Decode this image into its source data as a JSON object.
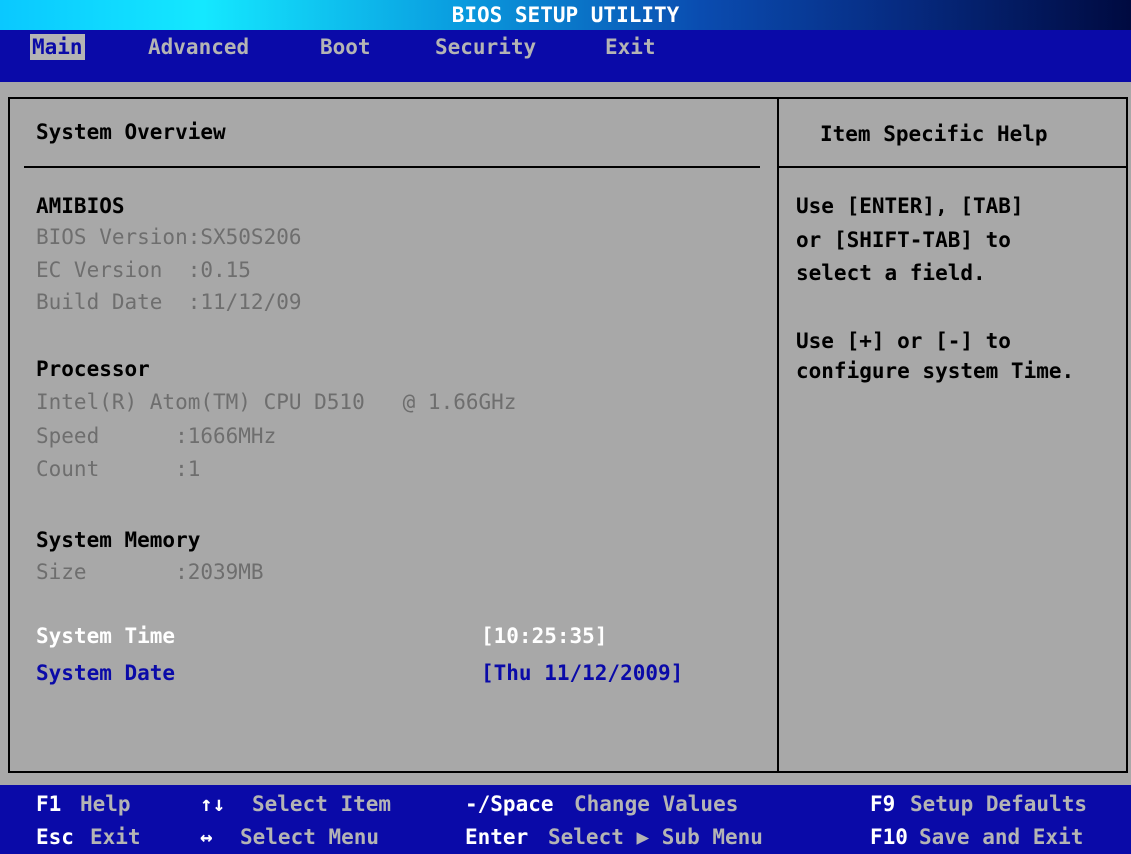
{
  "title": "BIOS SETUP UTILITY",
  "menu": [
    {
      "label": "Main",
      "active": true
    },
    {
      "label": "Advanced",
      "active": false
    },
    {
      "label": "Boot",
      "active": false
    },
    {
      "label": "Security",
      "active": false
    },
    {
      "label": "Exit",
      "active": false
    }
  ],
  "main": {
    "section_title": "System Overview",
    "amibios": {
      "heading": "AMIBIOS",
      "bios_version": "BIOS Version:SX50S206",
      "ec_version": "EC Version  :0.15",
      "build_date": "Build Date  :11/12/09"
    },
    "processor": {
      "heading": "Processor",
      "name": "Intel(R) Atom(TM) CPU D510   @ 1.66GHz",
      "speed": "Speed      :1666MHz",
      "count": "Count      :1"
    },
    "memory": {
      "heading": "System Memory",
      "size": "Size       :2039MB"
    },
    "system_time": {
      "label": "System Time",
      "value": "[10:25:35]"
    },
    "system_date": {
      "label": "System Date",
      "value": "[Thu 11/12/2009]"
    }
  },
  "help": {
    "title": "Item Specific Help",
    "lines": [
      "Use [ENTER], [TAB]",
      "or [SHIFT-TAB] to",
      "select a field.",
      "",
      "Use [+] or [-] to",
      "configure system Time."
    ]
  },
  "footer": {
    "f1_key": "F1",
    "f1_label": "Help",
    "select_item_key": "↑↓",
    "select_item_label": "Select Item",
    "change_key": "-/Space",
    "change_label": "Change Values",
    "f9_key": "F9",
    "f9_label": "Setup Defaults",
    "esc_key": "Esc",
    "esc_label": "Exit",
    "select_menu_key": "↔",
    "select_menu_label": "Select Menu",
    "enter_key": "Enter",
    "enter_label": "Select ▶ Sub Menu",
    "f10_key": "F10",
    "f10_label": "Save and Exit"
  },
  "colors": {
    "background": "#a8a8a8",
    "menubar": "#0a0aa8",
    "selected_text": "#ffffff",
    "item_text": "#0a0aa8",
    "info_text": "#6e6e6e"
  }
}
